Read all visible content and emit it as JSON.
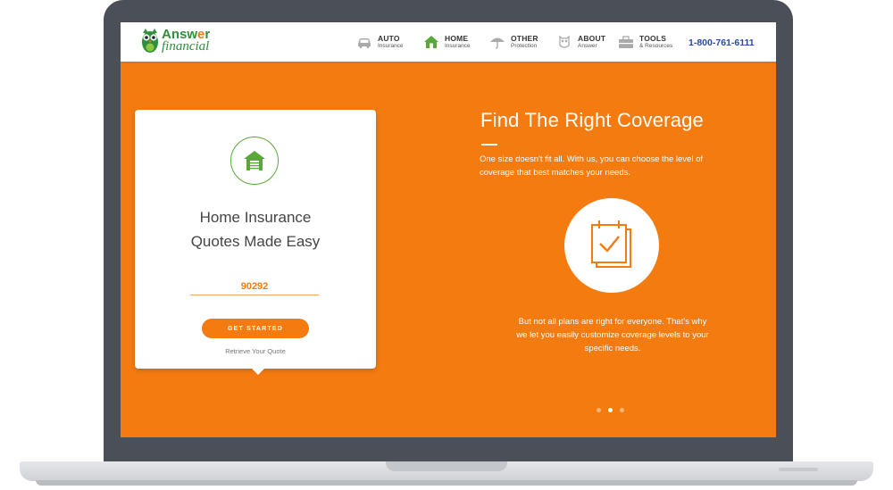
{
  "brand": {
    "line1_a": "Answ",
    "line1_o": "e",
    "line1_b": "r",
    "line2": "financial"
  },
  "nav": [
    {
      "label": "AUTO",
      "sub": "Insurance"
    },
    {
      "label": "HOME",
      "sub": "Insurance"
    },
    {
      "label": "OTHER",
      "sub": "Protection"
    },
    {
      "label": "ABOUT",
      "sub": "Answer"
    },
    {
      "label": "TOOLS",
      "sub": "& Resources"
    }
  ],
  "phone": "1-800-761-6111",
  "card": {
    "title_line1": "Home Insurance",
    "title_line2": "Quotes Made Easy",
    "zip_value": "90292",
    "cta": "GET STARTED",
    "retrieve": "Retrieve Your Quote"
  },
  "hero": {
    "headline": "Find The Right Coverage",
    "intro": "One size doesn't fit all. With us, you can choose the level of coverage that best matches your needs.",
    "body": "But not all plans are right for everyone. That's why we let you easily customize coverage levels to your specific needs."
  },
  "carousel": {
    "total": 3,
    "active": 2
  },
  "colors": {
    "accent": "#f47b10",
    "brand_green": "#2f8f3a",
    "phone_blue": "#2a4aa0",
    "frame": "#4b4f57"
  }
}
